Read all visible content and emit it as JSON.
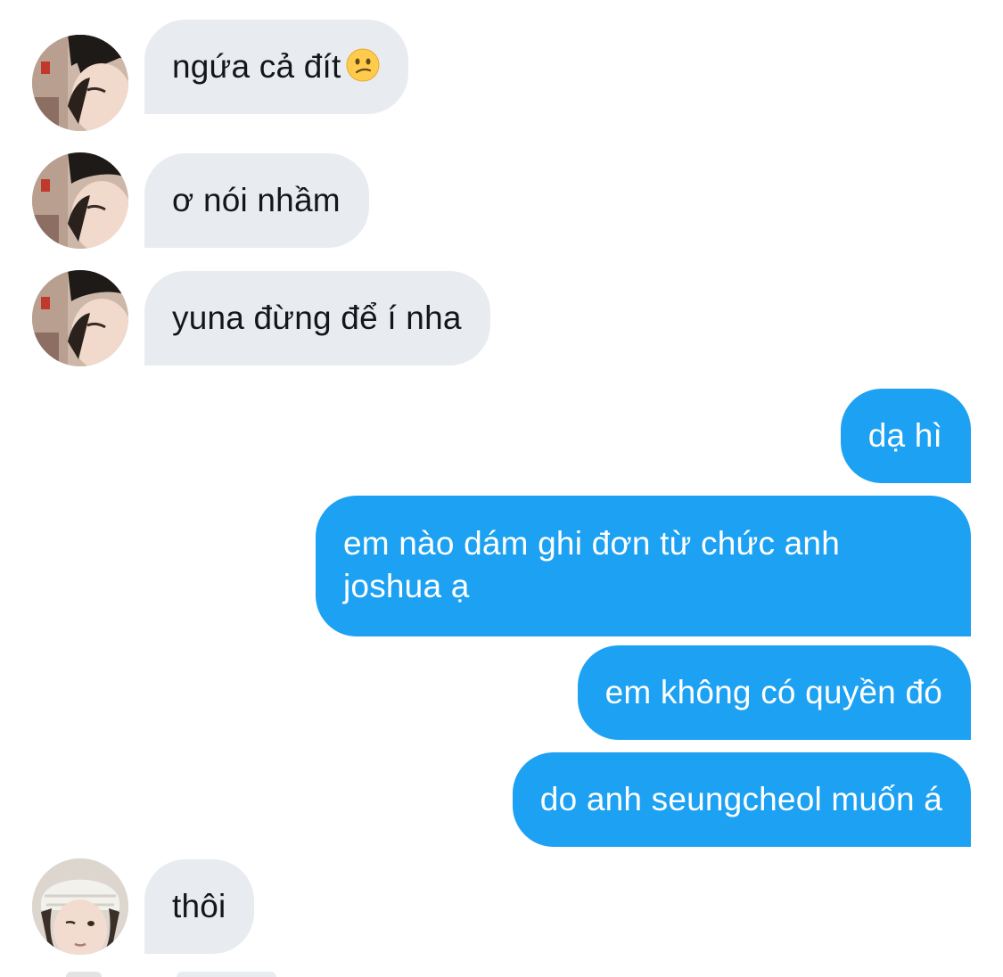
{
  "conversation": {
    "messages": [
      {
        "direction": "incoming",
        "text": "ngứa cả đít",
        "emoji": "confused-face-emoji",
        "avatar": "profile-photo-woman-lying"
      },
      {
        "direction": "incoming",
        "text": "ơ nói nhầm",
        "avatar": "profile-photo-woman-lying"
      },
      {
        "direction": "incoming",
        "text": "yuna đừng để í nha",
        "avatar": "profile-photo-woman-lying"
      },
      {
        "direction": "outgoing",
        "text": "dạ hì"
      },
      {
        "direction": "outgoing",
        "text": "em nào dám ghi đơn từ chức anh joshua ạ"
      },
      {
        "direction": "outgoing",
        "text": "em không có quyền đó"
      },
      {
        "direction": "outgoing",
        "text": "do anh seungcheol muốn á"
      },
      {
        "direction": "incoming",
        "text": "thôi",
        "avatar": "profile-photo-man-beanie"
      }
    ]
  },
  "colors": {
    "incoming_bubble": "#e8ecf0",
    "incoming_text": "#14171a",
    "outgoing_bubble": "#1da1f2",
    "outgoing_text": "#ffffff"
  }
}
